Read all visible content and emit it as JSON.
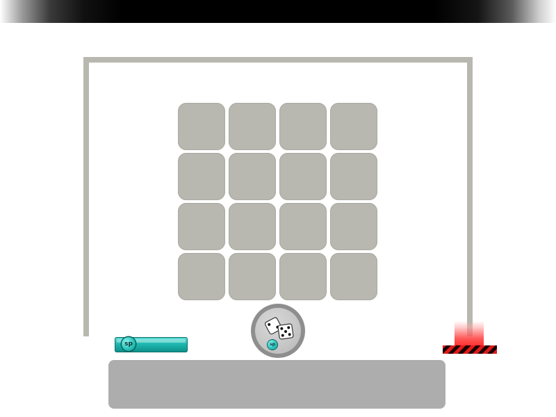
{
  "game": {
    "board": {
      "rows": 4,
      "cols": 4,
      "tile_color": "#b8b8b0",
      "frame_color": "#b8b8b0"
    },
    "sp_meter": {
      "label": "sp",
      "level": 1.0,
      "color": "#1fb8b0"
    },
    "dice_button": {
      "icon": "dice-icon",
      "badge": "sp"
    },
    "goal_marker": {
      "icon": "goal-marker",
      "color": "#e01a1a"
    },
    "message_panel": {
      "text": ""
    }
  }
}
